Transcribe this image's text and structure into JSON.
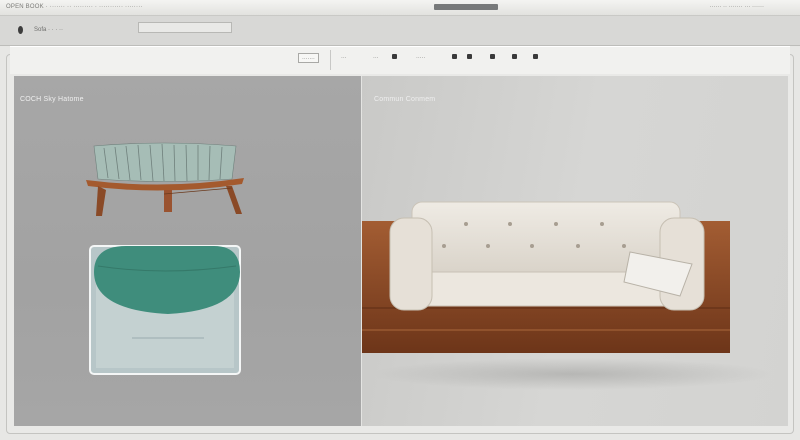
{
  "titlebar": {
    "left_text": "OPEN BOOK · ······· ·· ········· · ··········· ········",
    "right_text": "······ ·· ······· ··· ······"
  },
  "toolbar": {
    "crumb": "Sofa  ·  ·  ·  ··"
  },
  "subbar": {
    "buttons": [
      "·······",
      "···",
      "···",
      "·····"
    ]
  },
  "left_panel": {
    "caption": "COCH Sky Hatome"
  },
  "right_panel": {
    "caption": "Commun Conmem"
  },
  "colors": {
    "teal": "#3f8d7c",
    "walnut": "#8a4a27",
    "cream": "#e8e3db",
    "sage": "#a6bdb6"
  }
}
